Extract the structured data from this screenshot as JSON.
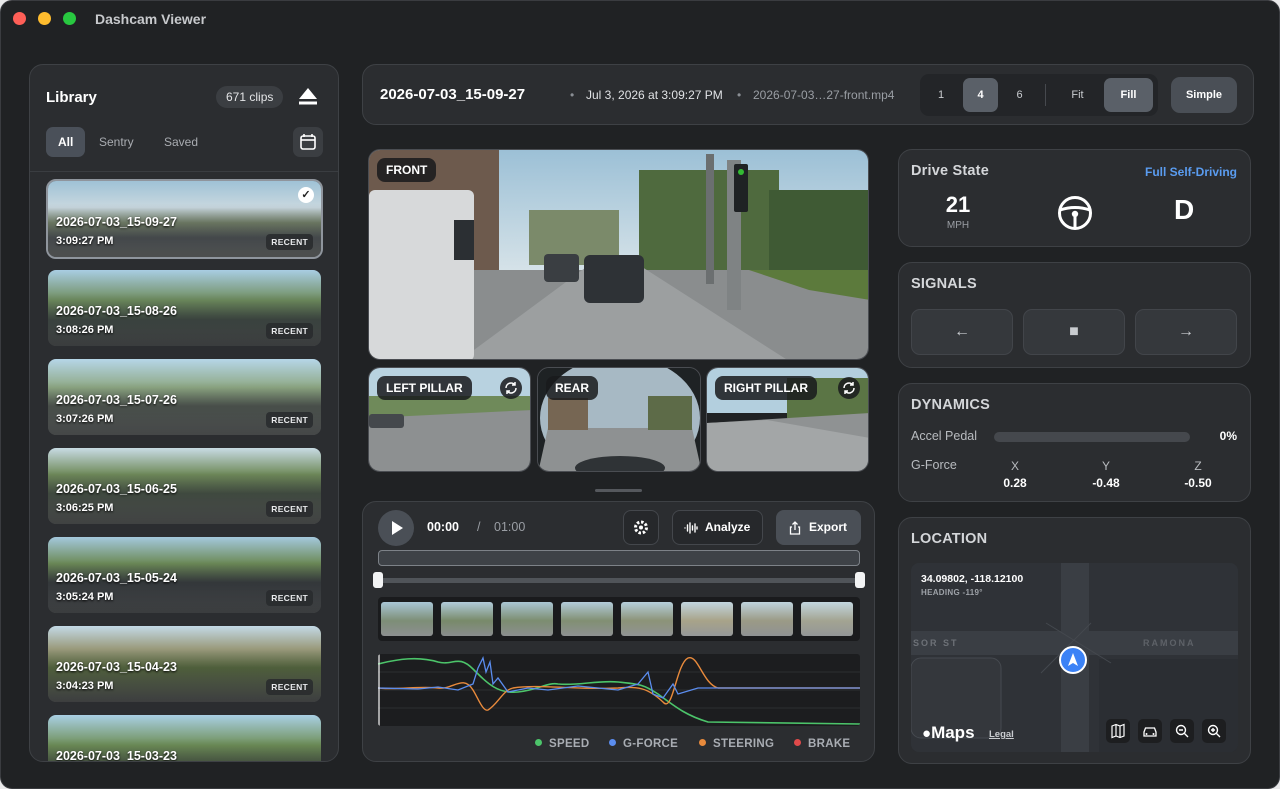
{
  "window": {
    "title": "Dashcam Viewer"
  },
  "library": {
    "title": "Library",
    "count": "671 clips",
    "filters": [
      "All",
      "Sentry",
      "Saved"
    ],
    "active_filter": "All",
    "clips": [
      {
        "name": "2026-07-03_15-09-27",
        "time": "3:09:27 PM",
        "badge": "RECENT",
        "selected": true
      },
      {
        "name": "2026-07-03_15-08-26",
        "time": "3:08:26 PM",
        "badge": "RECENT",
        "selected": false
      },
      {
        "name": "2026-07-03_15-07-26",
        "time": "3:07:26 PM",
        "badge": "RECENT",
        "selected": false
      },
      {
        "name": "2026-07-03_15-06-25",
        "time": "3:06:25 PM",
        "badge": "RECENT",
        "selected": false
      },
      {
        "name": "2026-07-03_15-05-24",
        "time": "3:05:24 PM",
        "badge": "RECENT",
        "selected": false
      },
      {
        "name": "2026-07-03_15-04-23",
        "time": "3:04:23 PM",
        "badge": "RECENT",
        "selected": false
      },
      {
        "name": "2026-07-03_15-03-23",
        "time": "",
        "badge": "",
        "selected": false
      }
    ]
  },
  "header": {
    "clip_name": "2026-07-03_15-09-27",
    "date": "Jul 3, 2026 at 3:09:27 PM",
    "file": "2026-07-03…27-front.mp4",
    "layout_options": [
      "1",
      "4",
      "6"
    ],
    "active_layout": "4",
    "fit_options": [
      "Fit",
      "Fill"
    ],
    "active_fit": "Fill",
    "simple_label": "Simple"
  },
  "cameras": {
    "front": "FRONT",
    "left_pillar": "LEFT PILLAR",
    "rear": "REAR",
    "right_pillar": "RIGHT PILLAR"
  },
  "player": {
    "current_time": "00:00",
    "separator": "/",
    "total_time": "01:00",
    "analyze_label": "Analyze",
    "export_label": "Export",
    "legend": [
      {
        "name": "SPEED",
        "color": "#4cc46a"
      },
      {
        "name": "G-FORCE",
        "color": "#5b8def"
      },
      {
        "name": "STEERING",
        "color": "#e88a3c"
      },
      {
        "name": "BRAKE",
        "color": "#e04a4a"
      }
    ]
  },
  "drive_state": {
    "title": "Drive State",
    "mode": "Full Self-Driving",
    "speed": "21",
    "speed_unit": "MPH",
    "gear": "D"
  },
  "signals": {
    "title": "SIGNALS",
    "left": "←",
    "center": "■",
    "right": "→"
  },
  "dynamics": {
    "title": "DYNAMICS",
    "accel_label": "Accel Pedal",
    "accel_value": "0%",
    "accel_fraction": 0,
    "gforce_label": "G-Force",
    "axes": [
      {
        "axis": "X",
        "value": "0.28"
      },
      {
        "axis": "Y",
        "value": "-0.48"
      },
      {
        "axis": "Z",
        "value": "-0.50"
      }
    ]
  },
  "location": {
    "title": "LOCATION",
    "coords": "34.09802, -118.12100",
    "heading": "HEADING -119°",
    "street_left": "SOR ST",
    "street_right": "RAMONA",
    "provider": "Maps",
    "legal": "Legal"
  },
  "colors": {
    "accent": "#5a9cf0",
    "panel": "#2b2d30",
    "background": "#202224"
  }
}
